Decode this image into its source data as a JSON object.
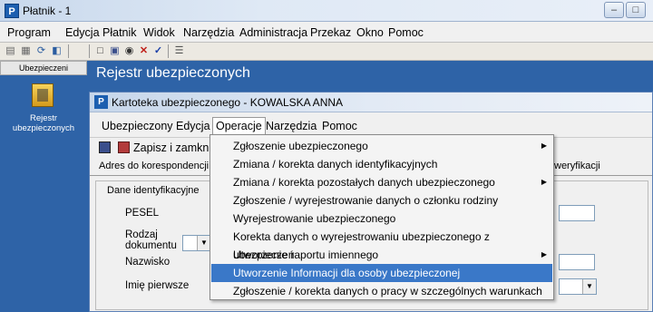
{
  "window": {
    "title": "Płatnik - 1",
    "min": "–",
    "max": "□"
  },
  "menubar": {
    "items": [
      "Program",
      "Edycja",
      "Płatnik",
      "Widok",
      "Narzędzia",
      "Administracja",
      "Przekaz",
      "Okno",
      "Pomoc"
    ]
  },
  "toolbar": {
    "icons": [
      "open-icon",
      "print-icon",
      "refresh-icon",
      "find-icon",
      "new-icon",
      "save-icon",
      "view-icon",
      "delete-icon",
      "check-icon",
      "filter-icon"
    ]
  },
  "sidebar": {
    "header": "Ubezpieczeni",
    "nav_label_1": "Rejestr",
    "nav_label_2": "ubezpieczonych"
  },
  "band": {
    "title": "Rejestr ubezpieczonych"
  },
  "child": {
    "title": "Kartoteka ubezpieczonego  - KOWALSKA ANNA",
    "menu": [
      "Ubezpieczony",
      "Edycja",
      "Operacje",
      "Narzędzia",
      "Pomoc"
    ],
    "toolbar": {
      "save_close": "Zapisz i zamknij"
    },
    "tabs": {
      "address": "Adres do korespondencji",
      "verification": "weryfikacji"
    },
    "panel": {
      "group": "Dane identyfikacyjne",
      "pesel": "PESEL",
      "doc_type_1": "Rodzaj",
      "doc_type_2": "dokumentu",
      "surname": "Nazwisko",
      "first_name": "Imię pierwsze"
    }
  },
  "dropdown": {
    "items": [
      "Zgłoszenie ubezpieczonego",
      "Zmiana / korekta danych identyfikacyjnych",
      "Zmiana / korekta pozostałych danych ubezpieczonego",
      "Zgłoszenie / wyrejestrowanie danych o członku rodziny",
      "Wyrejestrowanie  ubezpieczonego",
      "Korekta danych o wyrejestrowaniu ubezpieczonego z ubezpieczeń",
      "Utworzenie raportu imiennego",
      "Utworzenie Informacji dla osoby ubezpieczonej",
      "Zgłoszenie / korekta danych o pracy w szczególnych warunkach"
    ]
  }
}
